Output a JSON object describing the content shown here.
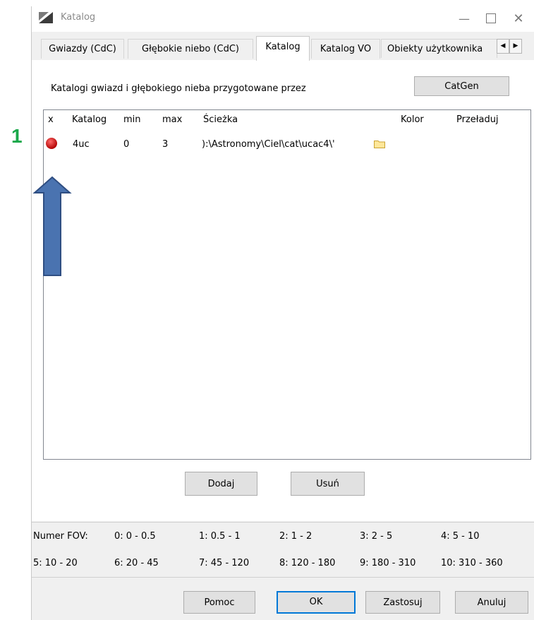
{
  "marker": "1",
  "window": {
    "title": "Katalog"
  },
  "tabs": [
    {
      "label": "Gwiazdy (CdC)"
    },
    {
      "label": "Głębokie niebo (CdC)"
    },
    {
      "label": "Katalog"
    },
    {
      "label": "Katalog VO"
    },
    {
      "label": "Obiekty użytkownika"
    }
  ],
  "page": {
    "description": "Katalogi gwiazd i głębokiego nieba przygotowane przez",
    "catgen_label": "CatGen"
  },
  "table": {
    "headers": [
      "x",
      "Katalog",
      "min",
      "max",
      "Ścieżka",
      "Kolor",
      "Przeładuj"
    ],
    "rows": [
      {
        "katalog": "4uc",
        "min": "0",
        "max": "3",
        "path": "):\\Astronomy\\Ciel\\cat\\ucac4\\'"
      }
    ]
  },
  "buttons": {
    "add": "Dodaj",
    "remove": "Usuń",
    "help": "Pomoc",
    "ok": "OK",
    "apply": "Zastosuj",
    "cancel": "Anuluj"
  },
  "fov": {
    "label": "Numer FOV:",
    "ranges": [
      "0: 0 - 0.5",
      "1: 0.5 - 1",
      "2: 1 - 2",
      "3: 2 - 5",
      "4: 5 - 10",
      "5: 10 - 20",
      "6: 20 - 45",
      "7: 45 - 120",
      "8: 120 - 180",
      "9: 180 - 310",
      "10: 310 - 360"
    ]
  },
  "colors": {
    "arrow_fill": "#4a73b0",
    "arrow_stroke": "#2f4e82",
    "marker": "#1aa84a",
    "status_dot": "#d01010",
    "focus": "#0078d7"
  },
  "icons": [
    "app-icon",
    "minimize-icon",
    "maximize-icon",
    "close-icon",
    "folder-icon",
    "red-dot-icon",
    "up-arrow"
  ]
}
